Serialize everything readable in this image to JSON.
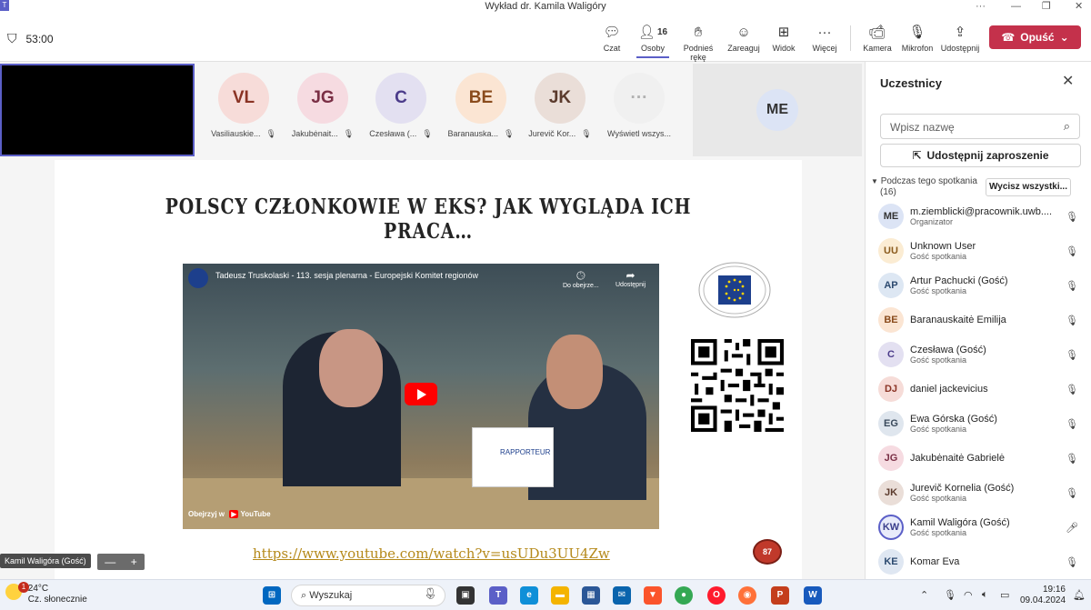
{
  "window": {
    "title": "Wykład dr. Kamila Waligóry",
    "app_logo": "T"
  },
  "toolbar": {
    "timer": "53:00",
    "chat": "Czat",
    "people": "Osoby",
    "people_count": "16",
    "raise_hand": "Podnieś rękę",
    "react": "Zareaguj",
    "view": "Widok",
    "more": "Więcej",
    "camera": "Kamera",
    "mic": "Mikrofon",
    "share": "Udostępnij",
    "leave": "Opuść"
  },
  "gallery": [
    {
      "initials": "VL",
      "name": "Vasiliauskie...",
      "bg": "#f7dcd9",
      "fg": "#8a3324"
    },
    {
      "initials": "JG",
      "name": "Jakubėnait...",
      "bg": "#f6dbe1",
      "fg": "#7a2f45"
    },
    {
      "initials": "C",
      "name": "Czesława (...",
      "bg": "#e3e0f1",
      "fg": "#4b3b8a"
    },
    {
      "initials": "BE",
      "name": "Baranauska...",
      "bg": "#fbe5d3",
      "fg": "#8a4b1c"
    },
    {
      "initials": "JK",
      "name": "Jurevič Kor...",
      "bg": "#eaded8",
      "fg": "#5b3a2c"
    },
    {
      "initials": "···",
      "name": "Wyświetl wszys...",
      "bg": "#f0f0f0",
      "fg": "#b0b0b0"
    }
  ],
  "me_tile": {
    "initials": "ME"
  },
  "slide": {
    "title": "POLSCY CZŁONKOWIE W EKS? JAK WYGLĄDA ICH PRACA…",
    "video_title": "Tadeusz Truskolaski - 113. sesja plenarna - Europejski Komitet regionów",
    "watch_later": "Do obejrze...",
    "share": "Udostępnij",
    "watch_on": "Obejrzyj w",
    "youtube": "YouTube",
    "rapporteur": "RAPPORTEUR",
    "link": "https://www.youtube.com/watch?v=usUDu3UU4Zw",
    "page": "87"
  },
  "speaker_label": "Kamil Waligóra (Gość)",
  "zoom": {
    "minus": "—",
    "plus": "+"
  },
  "panel": {
    "title": "Uczestnicy",
    "search_placeholder": "Wpisz nazwę",
    "invite": "Udostępnij zaproszenie",
    "section": "Podczas tego spotkania",
    "section_count": "(16)",
    "mute_all": "Wycisz wszystki...",
    "participants": [
      {
        "initials": "ME",
        "name": "m.ziemblicki@pracownik.uwb....",
        "role": "Organizator",
        "bg": "#dce4f5",
        "fg": "#333",
        "mic": "muted"
      },
      {
        "initials": "UU",
        "name": "Unknown User",
        "role": "Gość spotkania",
        "bg": "#fbecd3",
        "fg": "#8a5a1c",
        "mic": "muted"
      },
      {
        "initials": "AP",
        "name": "Artur Pachucki (Gość)",
        "role": "Gość spotkania",
        "bg": "#dde7f3",
        "fg": "#2c4a70",
        "mic": "muted"
      },
      {
        "initials": "BE",
        "name": "Baranauskaitė Emilija",
        "role": "",
        "bg": "#fbe5d3",
        "fg": "#8a4b1c",
        "mic": "muted"
      },
      {
        "initials": "C",
        "name": "Czesława (Gość)",
        "role": "Gość spotkania",
        "bg": "#e3e0f1",
        "fg": "#4b3b8a",
        "mic": "muted"
      },
      {
        "initials": "DJ",
        "name": "daniel jackevicius",
        "role": "",
        "bg": "#f6dcd8",
        "fg": "#8a3324",
        "mic": "muted"
      },
      {
        "initials": "EG",
        "name": "Ewa Górska (Gość)",
        "role": "Gość spotkania",
        "bg": "#dfe6ee",
        "fg": "#3a4a5c",
        "mic": "muted"
      },
      {
        "initials": "JG",
        "name": "Jakubėnaitė Gabrielė",
        "role": "",
        "bg": "#f6dbe1",
        "fg": "#7a2f45",
        "mic": "muted"
      },
      {
        "initials": "JK",
        "name": "Jurevič Kornelia (Gość)",
        "role": "Gość spotkania",
        "bg": "#eaded8",
        "fg": "#5b3a2c",
        "mic": "muted"
      },
      {
        "initials": "KW",
        "name": "Kamil Waligóra (Gość)",
        "role": "Gość spotkania",
        "bg": "#e8ebfa",
        "fg": "#3b3f8c",
        "mic": "on"
      },
      {
        "initials": "KE",
        "name": "Komar Eva",
        "role": "",
        "bg": "#dfe7f2",
        "fg": "#2c4a70",
        "mic": "muted"
      }
    ]
  },
  "taskbar": {
    "temp": "24°C",
    "weather": "Cz. słonecznie",
    "badge": "1",
    "search": "Wyszukaj",
    "time": "19:16",
    "date": "09.04.2024"
  }
}
